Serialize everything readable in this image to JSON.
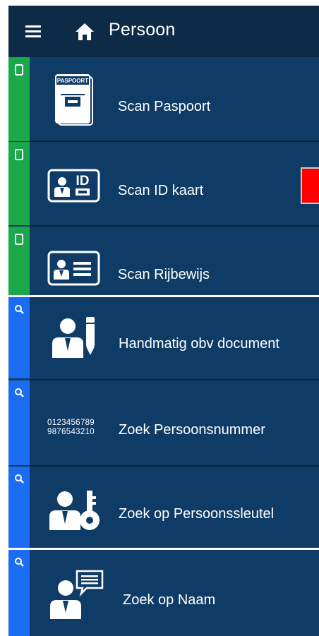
{
  "header": {
    "title": "Persoon",
    "menu_icon": "hamburger-menu-icon",
    "home_icon": "home-icon"
  },
  "colors": {
    "header_bg": "#0d2a47",
    "item_bg": "#0f3c66",
    "scan_stripe": "#1aa84a",
    "search_stripe": "#1a6cf0",
    "alert": "#ff0000"
  },
  "items": [
    {
      "label": "Scan Paspoort",
      "icon": "passport-icon",
      "passport_text": "PASPOORT",
      "stripe_icon": "phone-icon"
    },
    {
      "label": "Scan ID kaart",
      "icon": "id-card-icon",
      "badge": "ID",
      "stripe_icon": "phone-icon"
    },
    {
      "label": "Scan Rijbewijs",
      "icon": "driving-license-icon",
      "stripe_icon": "phone-icon"
    },
    {
      "label": "Handmatig obv document",
      "icon": "person-pencil-icon",
      "stripe_icon": "search-icon"
    },
    {
      "label": "Zoek Persoonsnummer",
      "icon": "number-icon",
      "number_line1": "0123456789",
      "number_line2": "9876543210",
      "stripe_icon": "search-icon"
    },
    {
      "label": "Zoek op Persoonssleutel",
      "icon": "person-key-icon",
      "stripe_icon": "search-icon"
    },
    {
      "label": "Zoek op Naam",
      "icon": "person-speech-icon",
      "stripe_icon": "search-icon"
    }
  ]
}
